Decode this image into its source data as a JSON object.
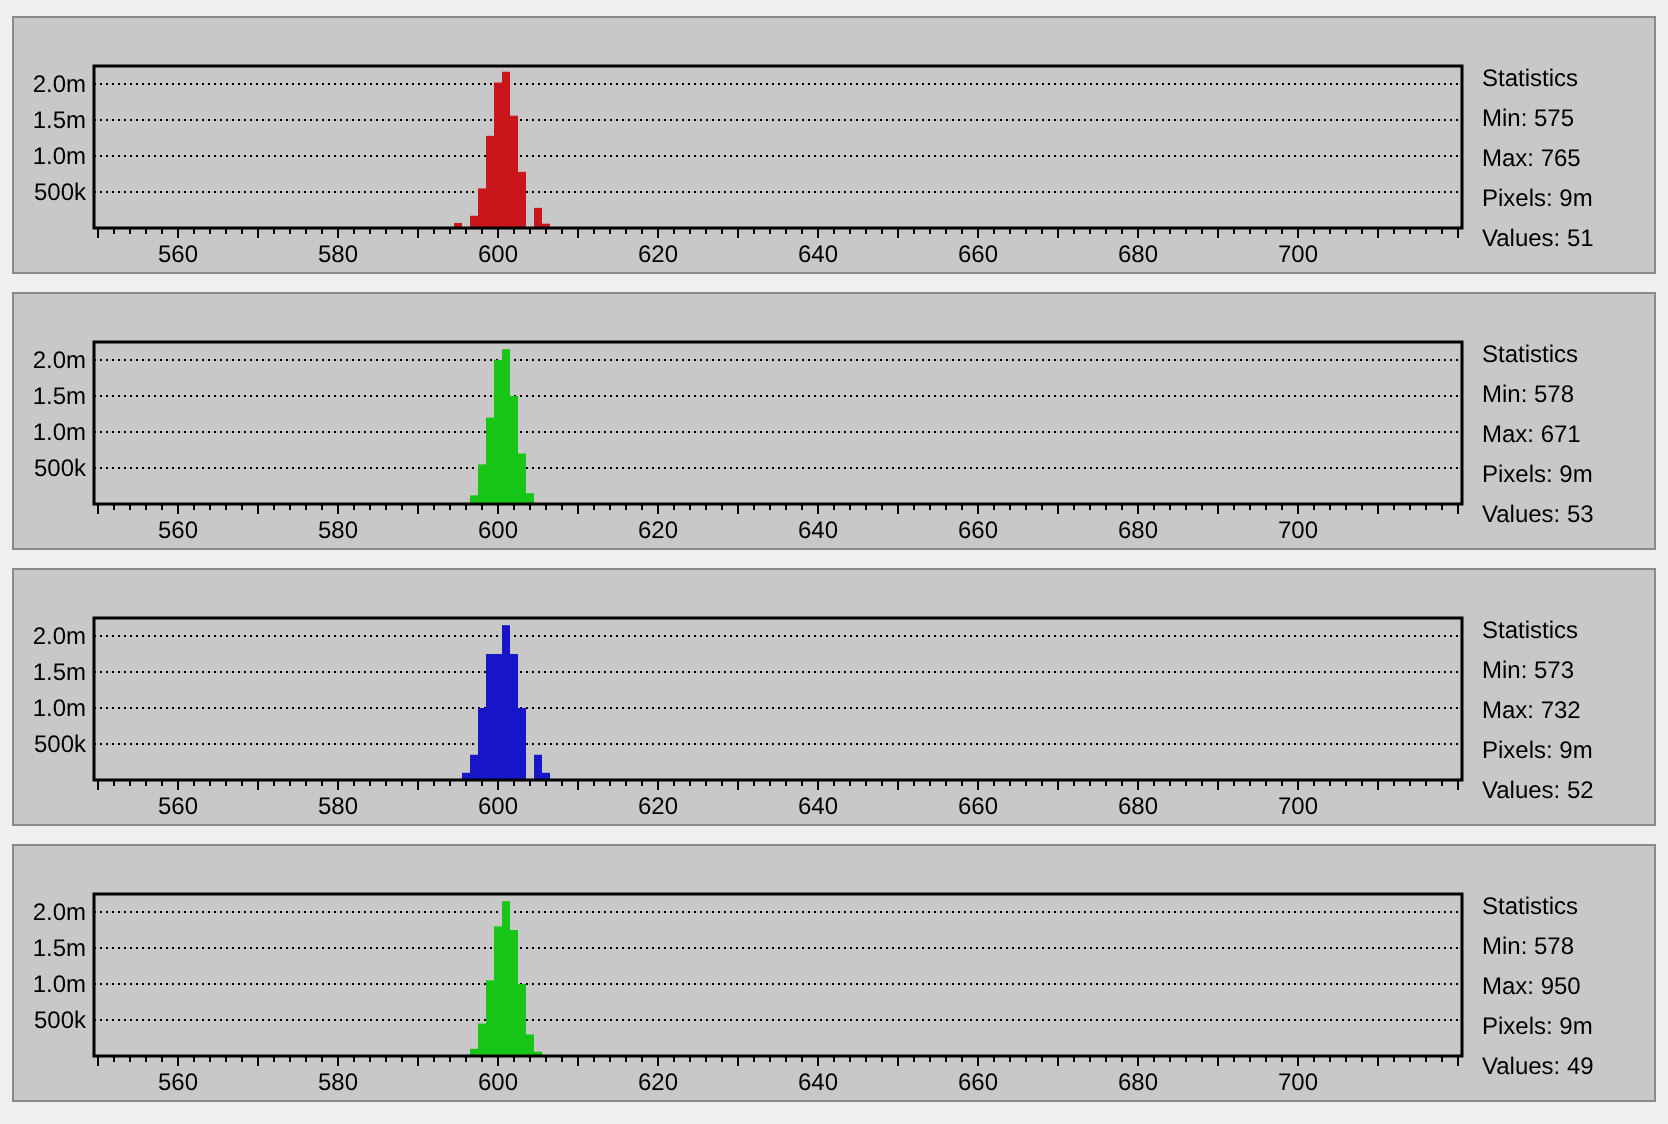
{
  "panels": [
    {
      "stats_title": "Statistics",
      "stats": [
        "Min: 575",
        "Max: 765",
        "Pixels: 9m",
        "Values: 51"
      ],
      "chart_data": {
        "type": "bar",
        "x": [
          595,
          597,
          598,
          599,
          600,
          601,
          602,
          603,
          605,
          606
        ],
        "grid": true,
        "series": [
          {
            "color": "#c8161a",
            "values": [
              70000,
              170000,
              550000,
              1280000,
              2020000,
              2170000,
              1560000,
              780000,
              280000,
              60000
            ]
          }
        ],
        "xlim": [
          549.5,
          720.5
        ],
        "ylim": [
          0,
          2250000
        ],
        "xticks": [
          560,
          580,
          600,
          620,
          640,
          660,
          680,
          700
        ],
        "yticks": [
          {
            "value": 500000,
            "label": "500k"
          },
          {
            "value": 1000000,
            "label": "1.0m"
          },
          {
            "value": 1500000,
            "label": "1.5m"
          },
          {
            "value": 2000000,
            "label": "2.0m"
          }
        ]
      }
    },
    {
      "stats_title": "Statistics",
      "stats": [
        "Min: 578",
        "Max: 671",
        "Pixels: 9m",
        "Values: 53"
      ],
      "chart_data": {
        "type": "bar",
        "x": [
          597,
          598,
          599,
          600,
          601,
          602,
          603,
          604
        ],
        "grid": true,
        "series": [
          {
            "color": "#16c516",
            "values": [
              120000,
              550000,
              1200000,
              2000000,
              2150000,
              1500000,
              700000,
              150000
            ]
          }
        ],
        "xlim": [
          549.5,
          720.5
        ],
        "ylim": [
          0,
          2250000
        ],
        "xticks": [
          560,
          580,
          600,
          620,
          640,
          660,
          680,
          700
        ],
        "yticks": [
          {
            "value": 500000,
            "label": "500k"
          },
          {
            "value": 1000000,
            "label": "1.0m"
          },
          {
            "value": 1500000,
            "label": "1.5m"
          },
          {
            "value": 2000000,
            "label": "2.0m"
          }
        ]
      }
    },
    {
      "stats_title": "Statistics",
      "stats": [
        "Min: 573",
        "Max: 732",
        "Pixels: 9m",
        "Values: 52"
      ],
      "chart_data": {
        "type": "bar",
        "x": [
          596,
          597,
          598,
          599,
          600,
          601,
          602,
          603,
          605,
          606
        ],
        "grid": true,
        "series": [
          {
            "color": "#1616c8",
            "values": [
              100000,
              350000,
              1000000,
              1750000,
              1750000,
              2150000,
              1750000,
              1000000,
              350000,
              100000
            ]
          }
        ],
        "xlim": [
          549.5,
          720.5
        ],
        "ylim": [
          0,
          2250000
        ],
        "xticks": [
          560,
          580,
          600,
          620,
          640,
          660,
          680,
          700
        ],
        "yticks": [
          {
            "value": 500000,
            "label": "500k"
          },
          {
            "value": 1000000,
            "label": "1.0m"
          },
          {
            "value": 1500000,
            "label": "1.5m"
          },
          {
            "value": 2000000,
            "label": "2.0m"
          }
        ]
      }
    },
    {
      "stats_title": "Statistics",
      "stats": [
        "Min: 578",
        "Max: 950",
        "Pixels: 9m",
        "Values: 49"
      ],
      "chart_data": {
        "type": "bar",
        "x": [
          597,
          598,
          599,
          600,
          601,
          602,
          603,
          604,
          605
        ],
        "grid": true,
        "series": [
          {
            "color": "#16c516",
            "values": [
              100000,
              450000,
              1050000,
              1800000,
              2150000,
              1750000,
              1000000,
              300000,
              60000
            ]
          }
        ],
        "xlim": [
          549.5,
          720.5
        ],
        "ylim": [
          0,
          2250000
        ],
        "xticks": [
          560,
          580,
          600,
          620,
          640,
          660,
          680,
          700
        ],
        "yticks": [
          {
            "value": 500000,
            "label": "500k"
          },
          {
            "value": 1000000,
            "label": "1.0m"
          },
          {
            "value": 1500000,
            "label": "1.5m"
          },
          {
            "value": 2000000,
            "label": "2.0m"
          }
        ]
      }
    }
  ]
}
